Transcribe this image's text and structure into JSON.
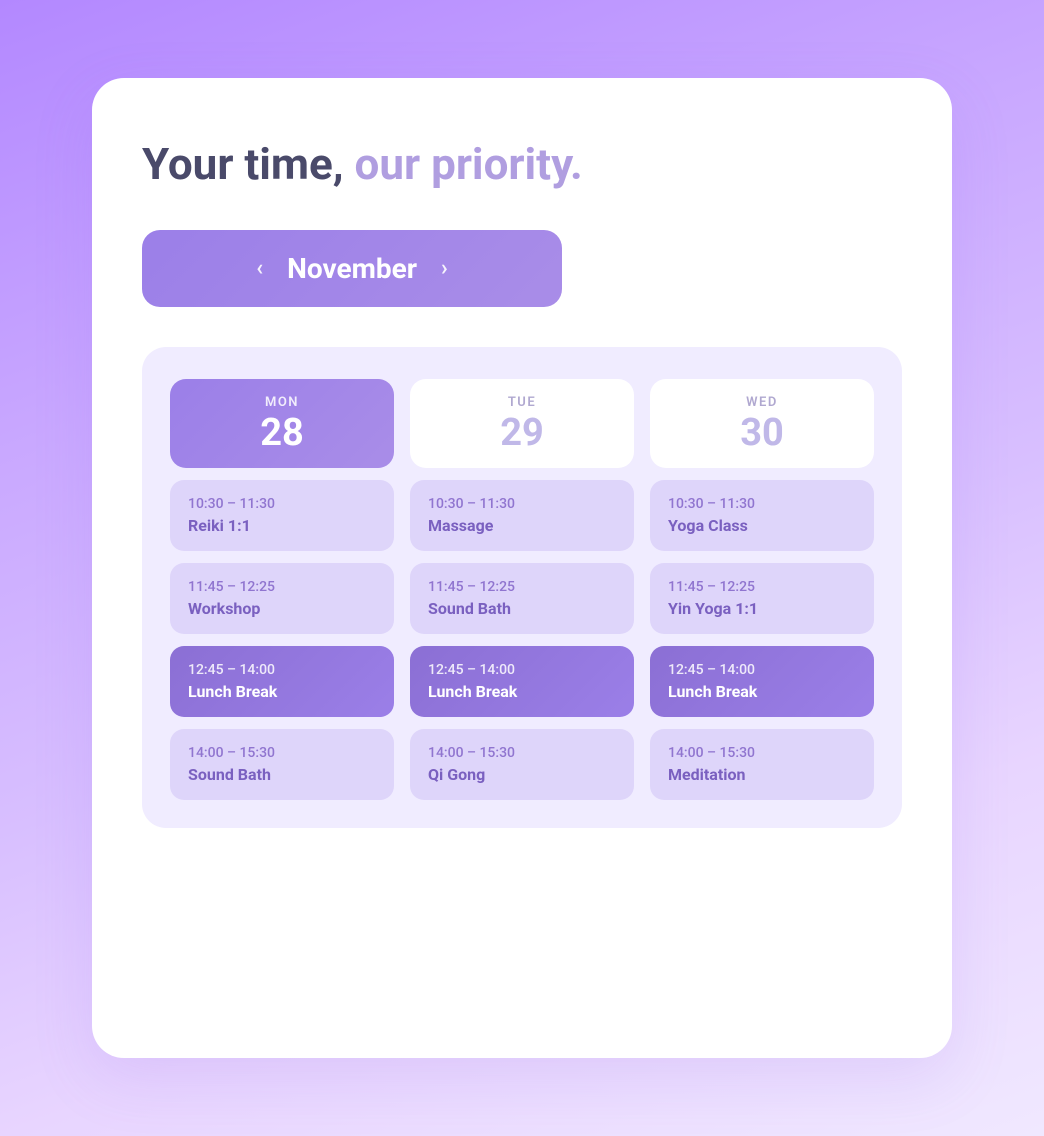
{
  "headline": {
    "part1": "Your time,",
    "part2": " our priority."
  },
  "monthNav": {
    "label": "November",
    "prevArrow": "‹",
    "nextArrow": "›"
  },
  "days": [
    {
      "name": "MON",
      "number": "28",
      "active": true
    },
    {
      "name": "TUE",
      "number": "29",
      "active": false
    },
    {
      "name": "WED",
      "number": "30",
      "active": false
    }
  ],
  "columns": [
    {
      "events": [
        {
          "time": "10:30 – 11:30",
          "name": "Reiki 1:1",
          "style": "light"
        },
        {
          "time": "11:45 – 12:25",
          "name": "Workshop",
          "style": "light"
        },
        {
          "time": "12:45 – 14:00",
          "name": "Lunch Break",
          "style": "dark"
        },
        {
          "time": "14:00 – 15:30",
          "name": "Sound Bath",
          "style": "light"
        }
      ]
    },
    {
      "events": [
        {
          "time": "10:30 – 11:30",
          "name": "Massage",
          "style": "light"
        },
        {
          "time": "11:45 – 12:25",
          "name": "Sound Bath",
          "style": "light"
        },
        {
          "time": "12:45 – 14:00",
          "name": "Lunch Break",
          "style": "dark"
        },
        {
          "time": "14:00 – 15:30",
          "name": "Qi Gong",
          "style": "light"
        }
      ]
    },
    {
      "events": [
        {
          "time": "10:30 – 11:30",
          "name": "Yoga Class",
          "style": "light"
        },
        {
          "time": "11:45 – 12:25",
          "name": "Yin Yoga 1:1",
          "style": "light"
        },
        {
          "time": "12:45 – 14:00",
          "name": "Lunch Break",
          "style": "dark"
        },
        {
          "time": "14:00 – 15:30",
          "name": "Meditation",
          "style": "light"
        }
      ]
    }
  ]
}
